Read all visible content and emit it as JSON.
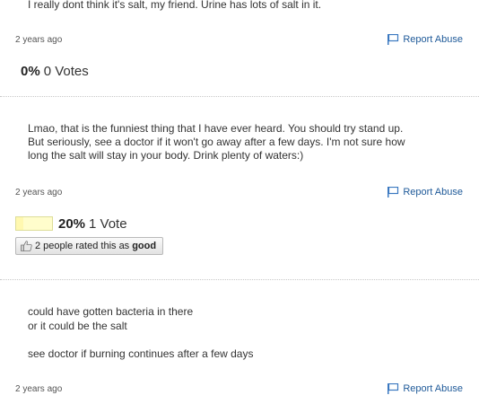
{
  "answers": [
    {
      "text": "I really dont think it's salt, my friend. Urine has lots of salt in it.",
      "timestamp": "2 years ago",
      "report": "Report Abuse",
      "percent": "0%",
      "percent_value": 0,
      "votes": "0 Votes"
    },
    {
      "lines": [
        "Lmao, that is the funniest thing that I have ever heard. You should try stand up.",
        "But seriously, see a doctor if it won't go away after a few days. I'm not sure how",
        "long the salt will stay in your body. Drink plenty of waters:)"
      ],
      "timestamp": "2 years ago",
      "report": "Report Abuse",
      "percent": "20%",
      "percent_value": 20,
      "votes": "1 Vote",
      "rated_prefix": "2 people rated this as",
      "rated_word": "good"
    },
    {
      "lines": [
        "could have gotten bacteria in there",
        "or it could be the salt",
        "",
        "see doctor if burning continues after a few days"
      ],
      "timestamp": "2 years ago",
      "report": "Report Abuse"
    }
  ],
  "colors": {
    "link": "#1f5a99",
    "vote_bar": "#fffdcc"
  }
}
